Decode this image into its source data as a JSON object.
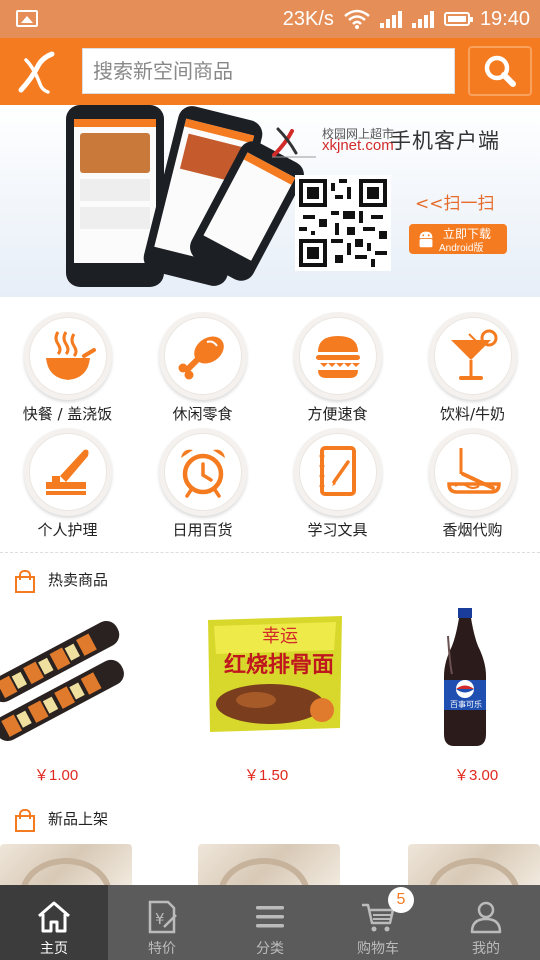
{
  "status_bar": {
    "speed": "23K/s",
    "time": "19:40",
    "icons": [
      "image-icon",
      "wifi-icon",
      "signal-icon",
      "signal-icon",
      "battery-icon"
    ]
  },
  "header": {
    "logo": "xkjnet-logo-icon",
    "search_placeholder": "搜索新空间商品",
    "search_icon": "search-icon"
  },
  "banner": {
    "site_small": "校园网上超市",
    "site_url": "xkjnet.com",
    "client_label": "手机客户端",
    "scan_label": "<<扫一扫",
    "download_label": "立即下载",
    "android_label": "Android版",
    "slide_count": 4,
    "active_slide": 4
  },
  "categories": [
    {
      "label": "快餐 / 盖浇饭",
      "icon": "bowl-icon"
    },
    {
      "label": "休闲零食",
      "icon": "drumstick-icon"
    },
    {
      "label": "方便速食",
      "icon": "burger-icon"
    },
    {
      "label": "饮料/牛奶",
      "icon": "cocktail-icon"
    },
    {
      "label": "个人护理",
      "icon": "lotion-icon"
    },
    {
      "label": "日用百货",
      "icon": "alarm-clock-icon"
    },
    {
      "label": "学习文具",
      "icon": "notebook-icon"
    },
    {
      "label": "香烟代购",
      "icon": "ashtray-icon"
    }
  ],
  "hot": {
    "title": "热卖商品",
    "products": [
      {
        "price": "￥1.00",
        "image": "sausage-image"
      },
      {
        "price": "￥1.50",
        "image": "instant-noodle-image",
        "pack_brand": "幸运",
        "pack_name": "红烧排骨面"
      },
      {
        "price": "￥3.00",
        "image": "pepsi-bottle-image",
        "bottle_label": "百事可乐"
      }
    ]
  },
  "new_arrivals": {
    "title": "新品上架"
  },
  "tabbar": {
    "tabs": [
      {
        "label": "主页",
        "icon": "home-icon"
      },
      {
        "label": "特价",
        "icon": "price-tag-icon"
      },
      {
        "label": "分类",
        "icon": "menu-icon"
      },
      {
        "label": "购物车",
        "icon": "cart-icon"
      },
      {
        "label": "我的",
        "icon": "user-icon"
      }
    ],
    "cart_count": "5",
    "active_tab": "主页"
  },
  "colors": {
    "brand_orange": "#f57b21",
    "status_bar": "#e58e57",
    "price_red": "#e0281e",
    "tabbar": "#5b5b5b",
    "tabbar_active": "#3c3c3c"
  }
}
